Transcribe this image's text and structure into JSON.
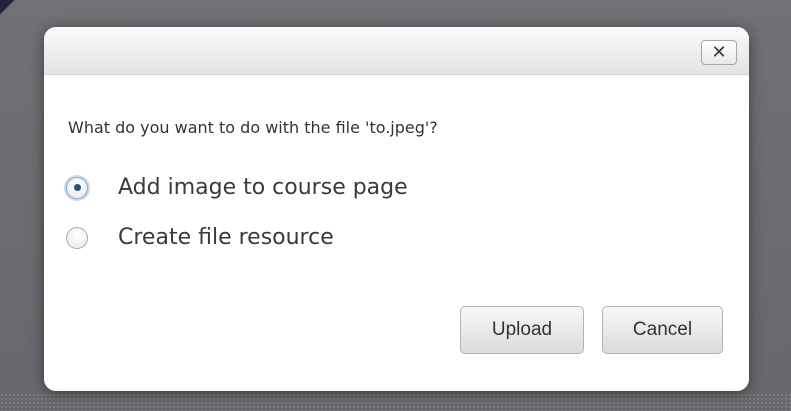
{
  "dialog": {
    "close_symbol": "✕",
    "question": "What do you want to do with the file 'to.jpeg'?",
    "options": [
      {
        "label": "Add image to course page",
        "checked": true
      },
      {
        "label": "Create file resource",
        "checked": false
      }
    ],
    "buttons": {
      "upload": "Upload",
      "cancel": "Cancel"
    }
  },
  "icons": {
    "close": "close-icon",
    "radio": "radio-button-icon"
  },
  "colors": {
    "backdrop": "#6f6f73",
    "dialog_bg": "#ffffff",
    "radio_selected_dot": "#2b4f7a"
  }
}
